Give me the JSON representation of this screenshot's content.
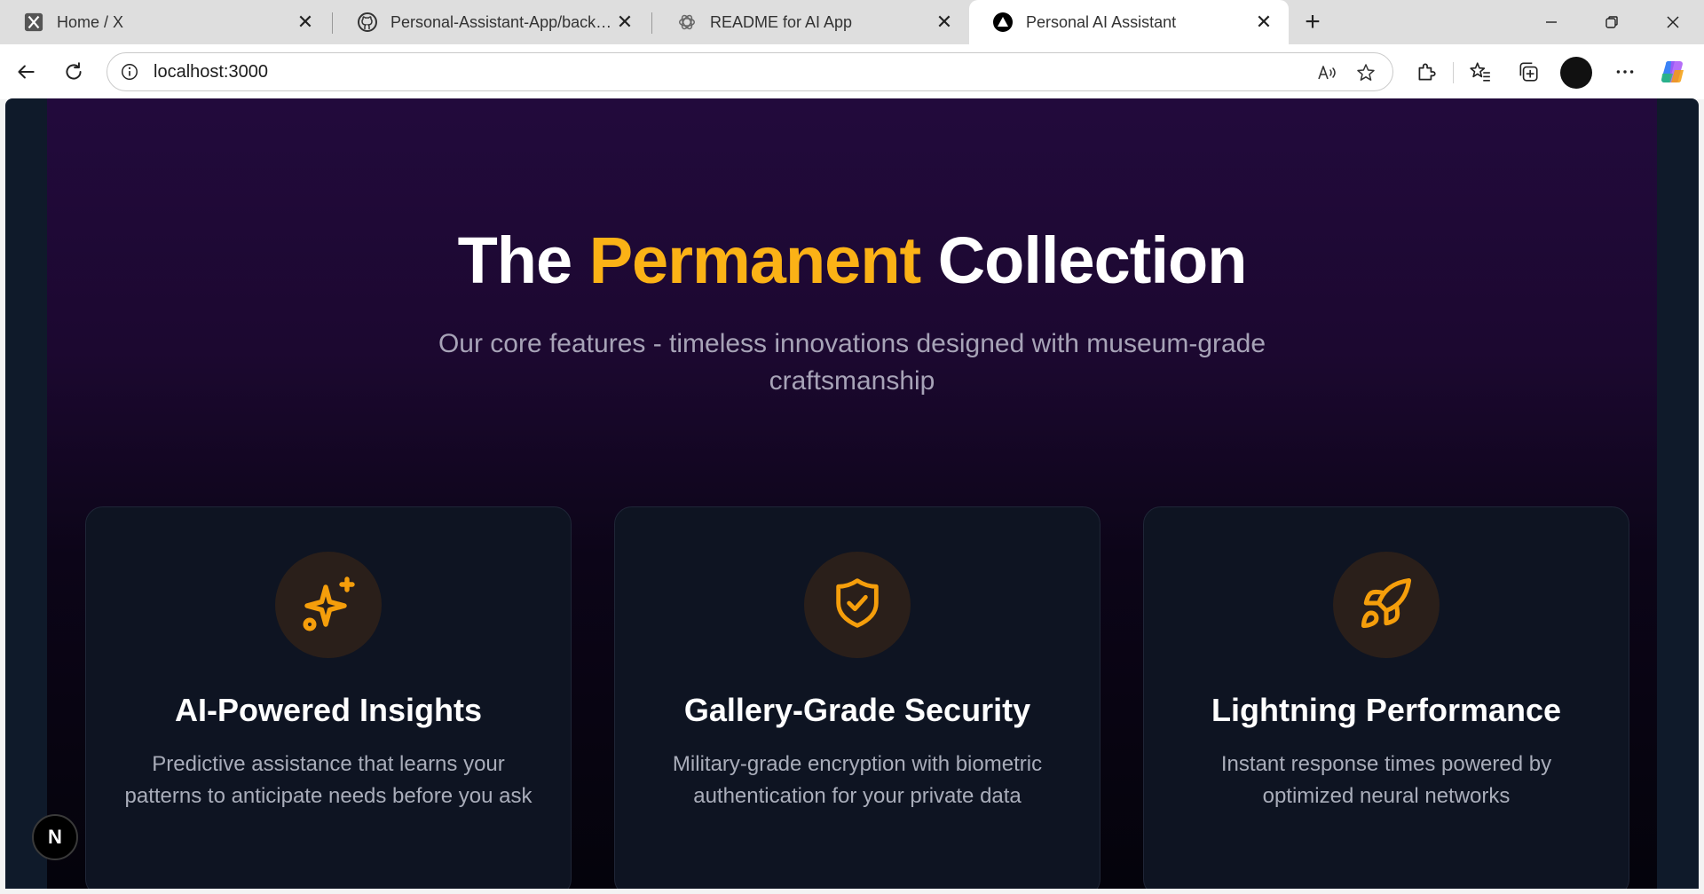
{
  "tabs": [
    {
      "title": "Home / X",
      "icon": "x-logo-icon"
    },
    {
      "title": "Personal-Assistant-App/backend/",
      "icon": "github-icon"
    },
    {
      "title": "README for AI App",
      "icon": "openai-icon"
    },
    {
      "title": "Personal AI Assistant",
      "icon": "vercel-triangle-icon",
      "active": true
    }
  ],
  "address": {
    "url": "localhost:3000"
  },
  "hero": {
    "title_part1": "The",
    "title_accent": "Permanent",
    "title_part2": "Collection",
    "subtitle": "Our core features - timeless innovations designed with museum-grade craftsmanship"
  },
  "features": [
    {
      "title": "AI-Powered Insights",
      "description": "Predictive assistance that learns your patterns to anticipate needs before you ask",
      "icon": "sparkles-icon"
    },
    {
      "title": "Gallery-Grade Security",
      "description": "Military-grade encryption with biometric authentication for your private data",
      "icon": "shield-check-icon"
    },
    {
      "title": "Lightning Performance",
      "description": "Instant response times powered by optimized neural networks",
      "icon": "rocket-icon"
    }
  ],
  "dev_badge": {
    "label": "N"
  },
  "colors": {
    "accent": "#fbb216",
    "icon_accent": "#f59e0b",
    "card_bg": "#0e1422",
    "hero_top": "#220a3c"
  }
}
